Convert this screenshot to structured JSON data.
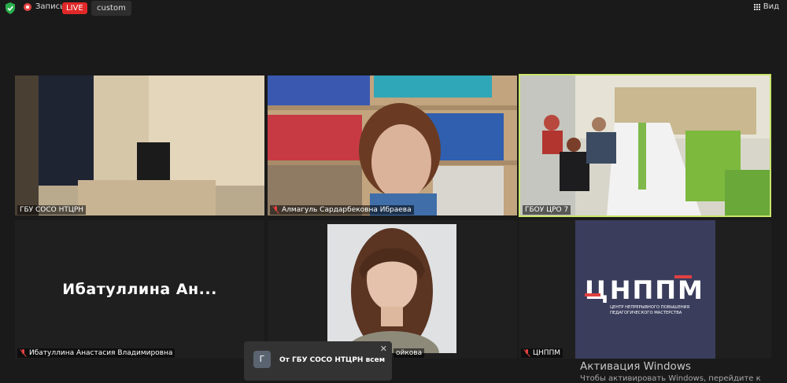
{
  "topbar": {
    "record_label": "Запись",
    "live_label": "LIVE",
    "custom_label": "custom",
    "view_label": "Вид"
  },
  "tiles": [
    {
      "name": "ГБУ СОСО НТЦРН",
      "muted": false
    },
    {
      "name": "Алмагуль Сардарбековна Ибраева",
      "muted": true
    },
    {
      "name": "ГБОУ ЦРО 7",
      "muted": false,
      "active_speaker": true
    },
    {
      "name": "Ибатуллина Анастасия Владимировна",
      "display_name": "Ибатуллина  Ан...",
      "muted": true
    },
    {
      "name": "ойкова",
      "muted": false
    },
    {
      "name": "ЦНППМ",
      "muted": true
    }
  ],
  "logo": {
    "word": "ЦНППМ",
    "subtitle": "ЦЕНТР НЕПРЕРЫВНОГО ПОВЫШЕНИЯ ПЕДАГОГИЧЕСКОГО МАСТЕРСТВА"
  },
  "toast": {
    "avatar_letter": "Г",
    "message": "От ГБУ СОСО НТЦРН всем"
  },
  "watermark": {
    "line1": "Активация Windows",
    "line2": "Чтобы активировать Windows, перейдите к"
  },
  "colors": {
    "background": "#1a1a1a",
    "live": "#e02828",
    "active_speaker_border": "#c9e56b",
    "muted_mic": "#e84040",
    "logo_bg": "#3a3d5c"
  }
}
